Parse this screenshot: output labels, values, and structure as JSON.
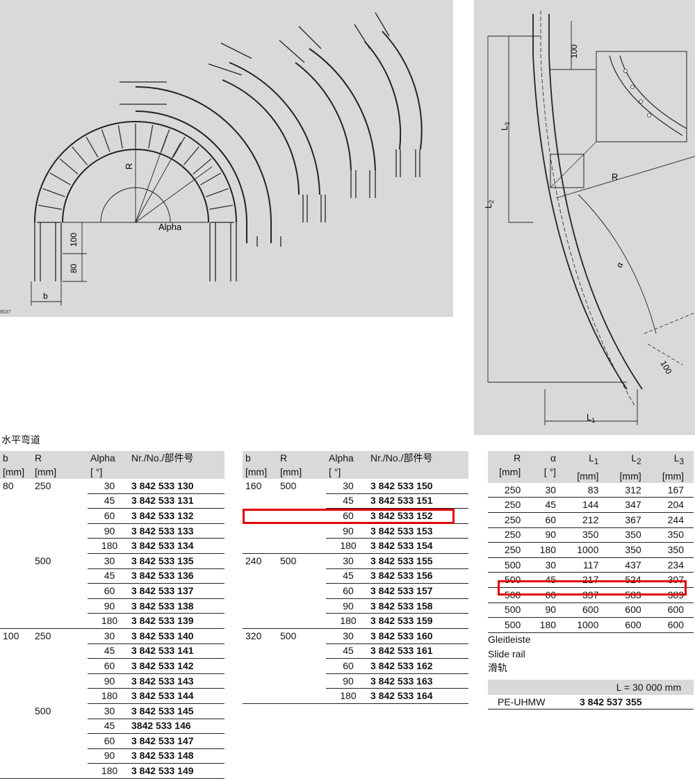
{
  "figure_left": {
    "label_R": "R",
    "label_alpha": "Alpha",
    "dim_100": "100",
    "dim_80": "80",
    "dim_b": "b",
    "fig_id": "8037"
  },
  "figure_right": {
    "label_L2": "L",
    "label_L2_sub": "2",
    "label_L3": "L",
    "label_L3_sub": "3",
    "label_L1": "L",
    "label_L1_sub": "1",
    "label_R": "R",
    "label_alpha": "α",
    "dim_100_top": "100",
    "dim_100_end": "100"
  },
  "section_title": "水平弯道",
  "table_left": {
    "headers": {
      "b": "b",
      "b_unit": "[mm]",
      "r": "R",
      "r_unit": "[mm]",
      "alpha": "Alpha",
      "alpha_unit": "[ °]",
      "nr": "Nr./No./部件号"
    },
    "rows": [
      {
        "b": "80",
        "r": "250",
        "a": "30",
        "nr": "3 842 533 130"
      },
      {
        "b": "",
        "r": "",
        "a": "45",
        "nr": "3 842 533 131"
      },
      {
        "b": "",
        "r": "",
        "a": "60",
        "nr": "3 842 533 132"
      },
      {
        "b": "",
        "r": "",
        "a": "90",
        "nr": "3 842 533 133"
      },
      {
        "b": "",
        "r": "",
        "a": "180",
        "nr": "3 842 533 134"
      },
      {
        "b": "",
        "r": "500",
        "a": "30",
        "nr": "3 842 533 135"
      },
      {
        "b": "",
        "r": "",
        "a": "45",
        "nr": "3 842 533 136"
      },
      {
        "b": "",
        "r": "",
        "a": "60",
        "nr": "3 842 533 137"
      },
      {
        "b": "",
        "r": "",
        "a": "90",
        "nr": "3 842 533 138"
      },
      {
        "b": "",
        "r": "",
        "a": "180",
        "nr": "3 842 533 139"
      },
      {
        "b": "100",
        "r": "250",
        "a": "30",
        "nr": "3 842 533 140"
      },
      {
        "b": "",
        "r": "",
        "a": "45",
        "nr": "3 842 533 141"
      },
      {
        "b": "",
        "r": "",
        "a": "60",
        "nr": "3 842 533 142"
      },
      {
        "b": "",
        "r": "",
        "a": "90",
        "nr": "3 842 533 143"
      },
      {
        "b": "",
        "r": "",
        "a": "180",
        "nr": "3 842 533 144"
      },
      {
        "b": "",
        "r": "500",
        "a": "30",
        "nr": "3 842 533 145"
      },
      {
        "b": "",
        "r": "",
        "a": "45",
        "nr": "3842 533 146"
      },
      {
        "b": "",
        "r": "",
        "a": "60",
        "nr": "3 842 533 147"
      },
      {
        "b": "",
        "r": "",
        "a": "90",
        "nr": "3 842 533 148"
      },
      {
        "b": "",
        "r": "",
        "a": "180",
        "nr": "3 842 533 149"
      }
    ]
  },
  "table_mid": {
    "headers": {
      "b": "b",
      "b_unit": "[mm]",
      "r": "R",
      "r_unit": "[mm]",
      "alpha": "Alpha",
      "alpha_unit": "[ °]",
      "nr": "Nr./No./部件号"
    },
    "rows": [
      {
        "b": "160",
        "r": "500",
        "a": "30",
        "nr": "3 842 533 150"
      },
      {
        "b": "",
        "r": "",
        "a": "45",
        "nr": "3 842 533 151"
      },
      {
        "b": "",
        "r": "",
        "a": "60",
        "nr": "3 842 533 152"
      },
      {
        "b": "",
        "r": "",
        "a": "90",
        "nr": "3 842 533 153"
      },
      {
        "b": "",
        "r": "",
        "a": "180",
        "nr": "3 842 533 154"
      },
      {
        "b": "240",
        "r": "500",
        "a": "30",
        "nr": "3 842 533 155"
      },
      {
        "b": "",
        "r": "",
        "a": "45",
        "nr": "3 842 533 156"
      },
      {
        "b": "",
        "r": "",
        "a": "60",
        "nr": "3 842 533 157"
      },
      {
        "b": "",
        "r": "",
        "a": "90",
        "nr": "3 842 533 158"
      },
      {
        "b": "",
        "r": "",
        "a": "180",
        "nr": "3 842 533 159"
      },
      {
        "b": "320",
        "r": "500",
        "a": "30",
        "nr": "3 842 533 160"
      },
      {
        "b": "",
        "r": "",
        "a": "45",
        "nr": "3 842 533 161"
      },
      {
        "b": "",
        "r": "",
        "a": "60",
        "nr": "3 842 533 162"
      },
      {
        "b": "",
        "r": "",
        "a": "90",
        "nr": "3 842 533 163"
      },
      {
        "b": "",
        "r": "",
        "a": "180",
        "nr": "3 842 533 164"
      }
    ]
  },
  "table_right": {
    "headers": {
      "r": "R",
      "r_unit": "[mm]",
      "alpha": "α",
      "alpha_unit": "[ °]",
      "l1": "L",
      "l1_sub": "1",
      "l1_unit": "[mm]",
      "l2": "L",
      "l2_sub": "2",
      "l2_unit": "[mm]",
      "l3": "L",
      "l3_sub": "3",
      "l3_unit": "[mm]"
    },
    "rows": [
      {
        "r": "250",
        "a": "30",
        "l1": "83",
        "l2": "312",
        "l3": "167"
      },
      {
        "r": "250",
        "a": "45",
        "l1": "144",
        "l2": "347",
        "l3": "204"
      },
      {
        "r": "250",
        "a": "60",
        "l1": "212",
        "l2": "367",
        "l3": "244"
      },
      {
        "r": "250",
        "a": "90",
        "l1": "350",
        "l2": "350",
        "l3": "350"
      },
      {
        "r": "250",
        "a": "180",
        "l1": "1000",
        "l2": "350",
        "l3": "350"
      },
      {
        "r": "500",
        "a": "30",
        "l1": "117",
        "l2": "437",
        "l3": "234"
      },
      {
        "r": "500",
        "a": "45",
        "l1": "217",
        "l2": "524",
        "l3": "307"
      },
      {
        "r": "500",
        "a": "60",
        "l1": "337",
        "l2": "583",
        "l3": "389"
      },
      {
        "r": "500",
        "a": "90",
        "l1": "600",
        "l2": "600",
        "l3": "600"
      },
      {
        "r": "500",
        "a": "180",
        "l1": "1000",
        "l2": "600",
        "l3": "600"
      }
    ]
  },
  "slide_rail": {
    "title_de": "Gleitleiste",
    "title_en": "Slide rail",
    "title_cn": "滑轨",
    "length": "L = 30 000 mm",
    "material": "PE-UHMW",
    "nr": "3 842 537 355"
  },
  "highlight_color": "#e00000"
}
